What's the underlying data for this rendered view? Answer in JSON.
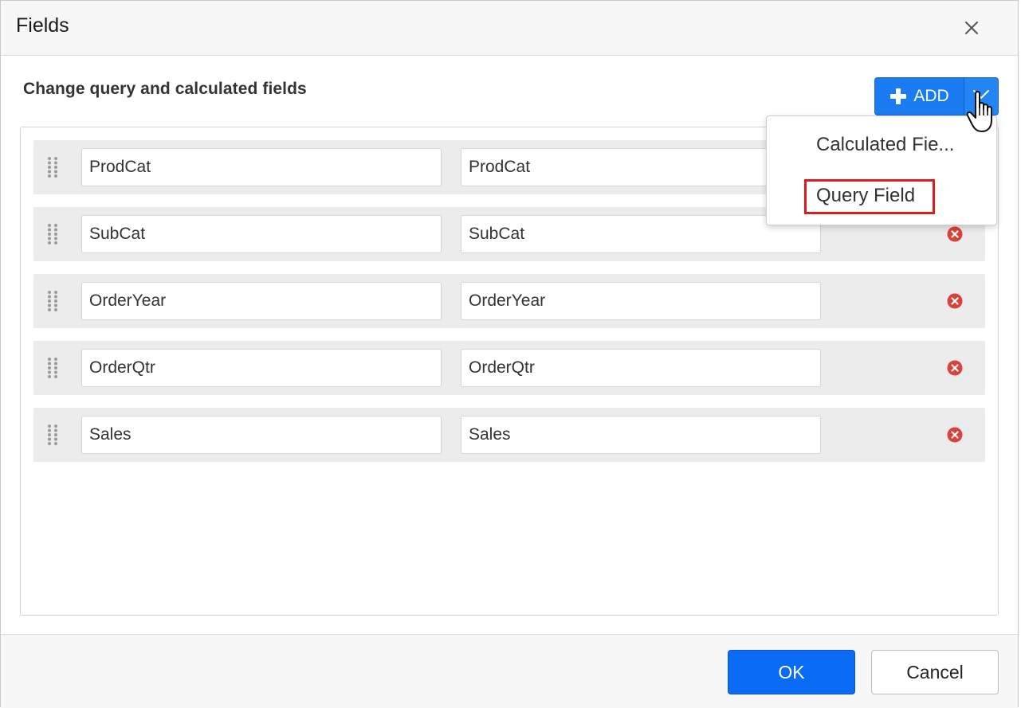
{
  "dialog": {
    "title": "Fields",
    "subtitle": "Change query and calculated fields"
  },
  "toolbar": {
    "add_label": "ADD"
  },
  "dropdown": {
    "items": [
      {
        "label": "Calculated Fie..."
      },
      {
        "label": "Query Field"
      }
    ]
  },
  "fields": [
    {
      "name": "ProdCat",
      "value": "ProdCat"
    },
    {
      "name": "SubCat",
      "value": "SubCat"
    },
    {
      "name": "OrderYear",
      "value": "OrderYear"
    },
    {
      "name": "OrderQtr",
      "value": "OrderQtr"
    },
    {
      "name": "Sales",
      "value": "Sales"
    }
  ],
  "footer": {
    "ok_label": "OK",
    "cancel_label": "Cancel"
  },
  "colors": {
    "accent": "#1a7cf0",
    "remove": "#d9423b",
    "highlight": "#e01b1b"
  }
}
